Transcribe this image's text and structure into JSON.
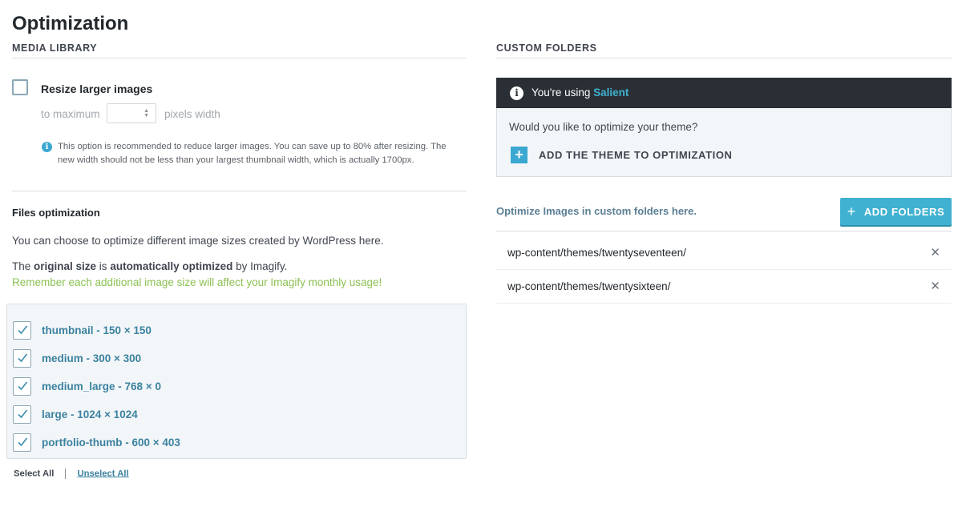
{
  "page": {
    "title": "Optimization"
  },
  "media_library": {
    "heading": "MEDIA LIBRARY",
    "resize": {
      "label": "Resize larger images",
      "checked": false,
      "to_maximum": "to maximum",
      "width_value": "",
      "unit": "pixels width",
      "help_line1": "This option is recommended to reduce larger images. You can save up to 80% after resizing. The",
      "help_line2": "new width should not be less than your largest thumbnail width, which is actually 1700px."
    },
    "files": {
      "heading": "Files optimization",
      "intro": "You can choose to optimize different image sizes created by WordPress here.",
      "original_pre": "The ",
      "original_bold1": "original size",
      "original_mid": " is ",
      "original_bold2": "automatically optimized",
      "original_post": " by Imagify.",
      "reminder": "Remember each additional image size will affect your Imagify monthly usage!",
      "sizes": [
        {
          "label": "thumbnail - 150 × 150",
          "checked": true
        },
        {
          "label": "medium - 300 × 300",
          "checked": true
        },
        {
          "label": "medium_large - 768 × 0",
          "checked": true
        },
        {
          "label": "large - 1024 × 1024",
          "checked": true
        },
        {
          "label": "portfolio-thumb - 600 × 403",
          "checked": true
        }
      ],
      "select_all": "Select All",
      "unselect_all": "Unselect All"
    }
  },
  "custom_folders": {
    "heading": "CUSTOM FOLDERS",
    "theme_notice": {
      "using_prefix": "You're using ",
      "theme_name": "Salient",
      "question": "Would you like to optimize your theme?",
      "add_theme": "ADD THE THEME TO OPTIMIZATION"
    },
    "optimize_label": "Optimize Images in custom folders here.",
    "add_folders": "ADD FOLDERS",
    "folders": [
      {
        "path": "wp-content/themes/twentyseventeen/"
      },
      {
        "path": "wp-content/themes/twentysixteen/"
      }
    ]
  },
  "colors": {
    "accent": "#40b1d0",
    "link": "#3b82a0",
    "notice_dark": "#2a2f35",
    "reminder_green": "#8cc152"
  }
}
